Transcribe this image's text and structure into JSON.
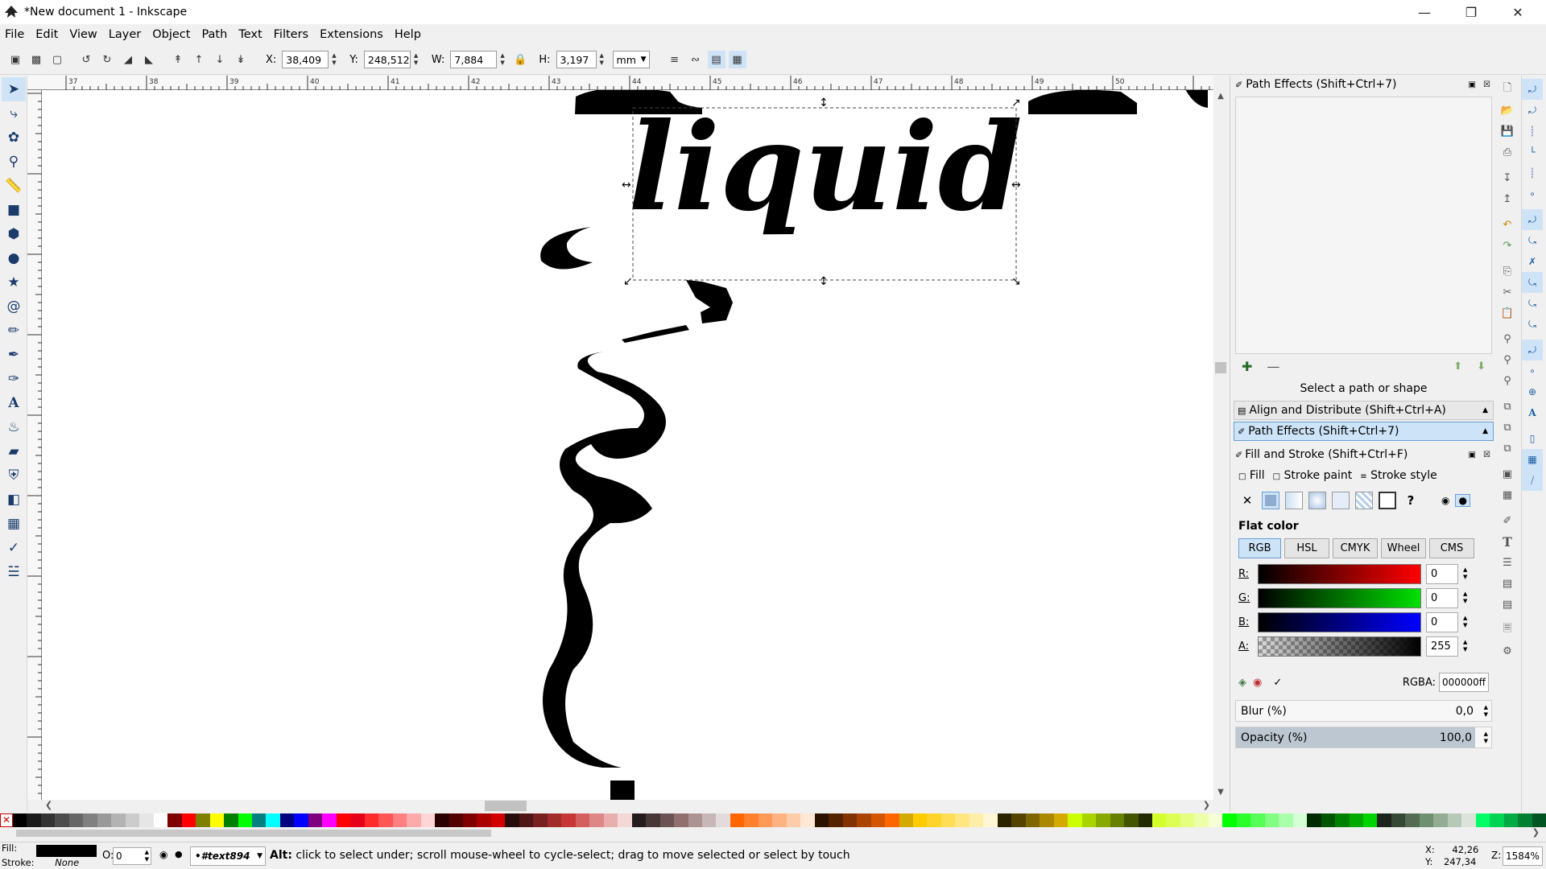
{
  "window": {
    "title": "*New document 1 - Inkscape",
    "controls": [
      "minimize",
      "maximize",
      "close"
    ]
  },
  "menu": [
    "File",
    "Edit",
    "View",
    "Layer",
    "Object",
    "Path",
    "Text",
    "Filters",
    "Extensions",
    "Help"
  ],
  "tool_controls": {
    "x_label": "X:",
    "x_value": "38,409",
    "y_label": "Y:",
    "y_value": "248,512",
    "w_label": "W:",
    "w_value": "7,884",
    "h_label": "H:",
    "h_value": "3,197",
    "unit": "mm"
  },
  "ruler": {
    "top_ticks": [
      "37",
      "38",
      "39",
      "40",
      "41",
      "42",
      "43",
      "44",
      "45",
      "46",
      "47",
      "48",
      "49",
      "50"
    ]
  },
  "canvas": {
    "text_object": "liquid",
    "selected_object_id": "#text894"
  },
  "path_effects": {
    "title": "Path Effects  (Shift+Ctrl+7)",
    "status": "Select a path or shape"
  },
  "collapsed_panels": {
    "align": "Align and Distribute (Shift+Ctrl+A)",
    "path_effects": "Path Effects  (Shift+Ctrl+7)"
  },
  "fill_stroke": {
    "title": "Fill and Stroke (Shift+Ctrl+F)",
    "tabs": [
      "Fill",
      "Stroke paint",
      "Stroke style"
    ],
    "paint_type": "Flat color",
    "color_modes": [
      "RGB",
      "HSL",
      "CMYK",
      "Wheel",
      "CMS"
    ],
    "channels": [
      {
        "label": "R:",
        "value": "0",
        "color": "#ff0000"
      },
      {
        "label": "G:",
        "value": "0",
        "color": "#00e000"
      },
      {
        "label": "B:",
        "value": "0",
        "color": "#0000ff"
      },
      {
        "label": "A:",
        "value": "255",
        "color": "#000000"
      }
    ],
    "rgba_label": "RGBA:",
    "rgba_value": "000000ff",
    "blur_label": "Blur (%)",
    "blur_value": "0,0",
    "opacity_label": "Opacity (%)",
    "opacity_value": "100,0"
  },
  "palette": [
    "#000000",
    "#1a1a1a",
    "#333333",
    "#4d4d4d",
    "#666666",
    "#808080",
    "#999999",
    "#b3b3b3",
    "#cccccc",
    "#e6e6e6",
    "#ffffff",
    "#800000",
    "#ff0000",
    "#808000",
    "#ffff00",
    "#008000",
    "#00ff00",
    "#008080",
    "#00ffff",
    "#000080",
    "#0000ff",
    "#800080",
    "#ff00ff",
    "#ff0000",
    "#e6001a",
    "#ff2a2a",
    "#ff5555",
    "#ff8080",
    "#ffaaaa",
    "#ffd5d5",
    "#2b0000",
    "#550000",
    "#800000",
    "#aa0000",
    "#d40000",
    "#280b0b",
    "#501616",
    "#782121",
    "#a02c2c",
    "#c83737",
    "#d35f5f",
    "#de8787",
    "#e9afaf",
    "#f4d7d7",
    "#241c1c",
    "#483737",
    "#6c5353",
    "#916f6f",
    "#ac9393",
    "#c8b7b7",
    "#e3dbdb",
    "#ff6600",
    "#ff7f2a",
    "#ff9955",
    "#ffb380",
    "#ffccaa",
    "#ffe6d5",
    "#2b1100",
    "#552200",
    "#803300",
    "#aa4400",
    "#d45500",
    "#ff6600",
    "#d4aa00",
    "#ffcc00",
    "#ffd42a",
    "#ffdd55",
    "#ffe680",
    "#ffeeaa",
    "#fff6d5",
    "#2b2200",
    "#554400",
    "#806600",
    "#aa8800",
    "#d4aa00",
    "#ccff00",
    "#aad400",
    "#88aa00",
    "#668000",
    "#445500",
    "#222b00",
    "#d4ff2a",
    "#ddff55",
    "#e5ff80",
    "#eeffaa",
    "#f6ffd5",
    "#00ff00",
    "#2aff2a",
    "#55ff55",
    "#80ff80",
    "#aaffaa",
    "#d5ffd5",
    "#002b00",
    "#005500",
    "#008000",
    "#00aa00",
    "#00d400",
    "#1c241c",
    "#374837",
    "#536c53",
    "#6f916f",
    "#93ac93",
    "#b7c8b7",
    "#dbe3db",
    "#00ff66",
    "#00d455",
    "#00aa44",
    "#008033",
    "#005522"
  ],
  "status": {
    "fill_label": "Fill:",
    "stroke_label": "Stroke:",
    "stroke_value": "None",
    "opacity_label": "O:",
    "opacity_value": "0",
    "layer": "•#text894",
    "message_bold": "Alt:",
    "message": " click to select under; scroll mouse-wheel to cycle-select; drag to move selected or select by touch",
    "x_label": "X:",
    "x_value": "42,26",
    "y_label": "Y:",
    "y_value": "247,34",
    "zoom_label": "Z:",
    "zoom_value": "1584%"
  }
}
